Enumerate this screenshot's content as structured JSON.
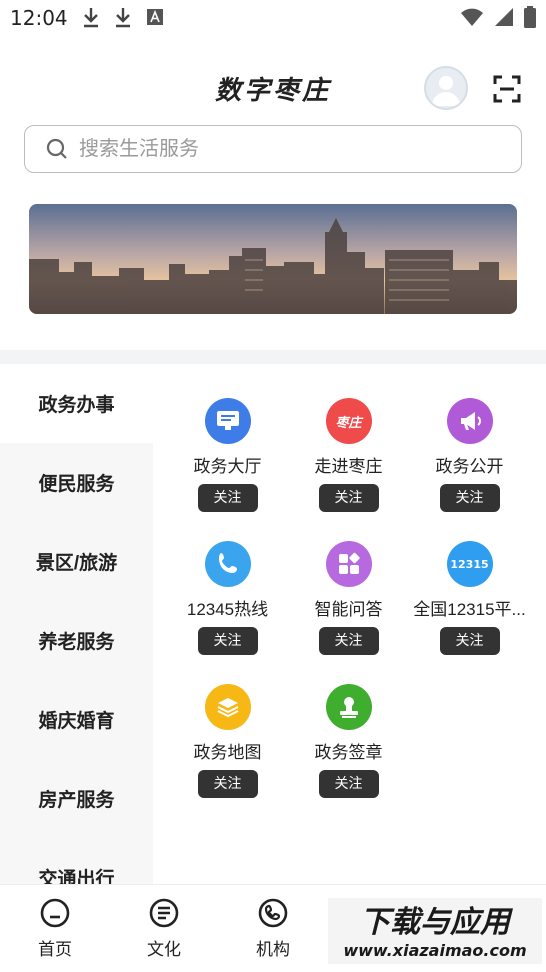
{
  "status_bar": {
    "time": "12:04"
  },
  "header": {
    "title": "数字枣庄"
  },
  "search": {
    "placeholder": "搜索生活服务"
  },
  "categories": [
    {
      "label": "政务办事"
    },
    {
      "label": "便民服务"
    },
    {
      "label": "景区/旅游"
    },
    {
      "label": "养老服务"
    },
    {
      "label": "婚庆婚育"
    },
    {
      "label": "房产服务"
    },
    {
      "label": "交通出行"
    }
  ],
  "services": [
    {
      "label": "政务大厅",
      "follow": "关注",
      "icon": "hall-icon",
      "color": "#3e7ce8",
      "badge": ""
    },
    {
      "label": "走进枣庄",
      "follow": "关注",
      "icon": "zaozhuang-icon",
      "color": "#ef4b4b",
      "badge": "枣庄"
    },
    {
      "label": "政务公开",
      "follow": "关注",
      "icon": "megaphone-icon",
      "color": "#b05ad8",
      "badge": ""
    },
    {
      "label": "12345热线",
      "follow": "关注",
      "icon": "phone-icon",
      "color": "#3aa5ee",
      "badge": ""
    },
    {
      "label": "智能问答",
      "follow": "关注",
      "icon": "apps-icon",
      "color": "#b76ae0",
      "badge": ""
    },
    {
      "label": "全国12315平...",
      "follow": "关注",
      "icon": "12315-icon",
      "color": "#2f9ef0",
      "badge": "12315"
    },
    {
      "label": "政务地图",
      "follow": "关注",
      "icon": "layers-icon",
      "color": "#f7b815",
      "badge": ""
    },
    {
      "label": "政务签章",
      "follow": "关注",
      "icon": "stamp-icon",
      "color": "#3fae2e",
      "badge": ""
    }
  ],
  "bottom_nav": [
    {
      "label": "首页",
      "icon": "home-icon"
    },
    {
      "label": "文化",
      "icon": "culture-icon"
    },
    {
      "label": "机构",
      "icon": "org-icon"
    }
  ],
  "colors": {
    "active_tab_bg": "#ffffff",
    "sidebar_bg": "#f7f7f7",
    "follow_bg": "#333333"
  }
}
